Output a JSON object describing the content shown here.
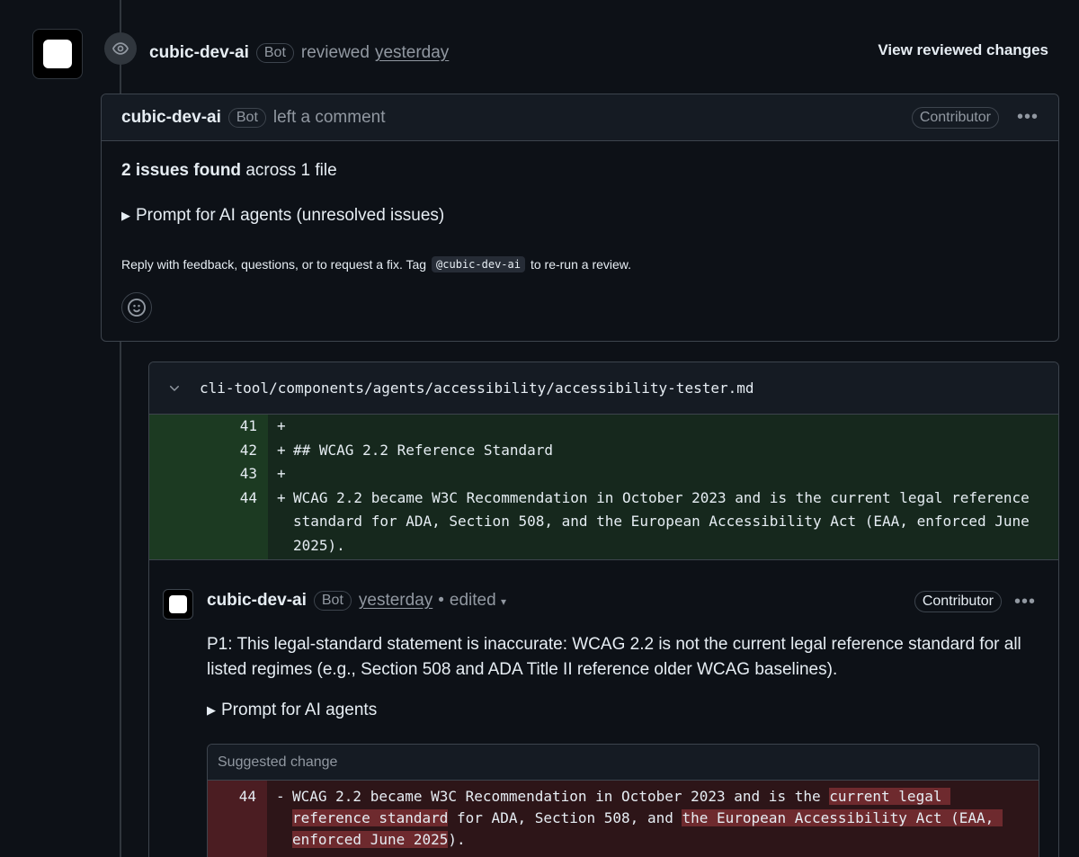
{
  "review": {
    "author": "cubic-dev-ai",
    "bot_label": "Bot",
    "action": "reviewed",
    "time": "yesterday",
    "view_changes": "View reviewed changes"
  },
  "comment": {
    "author": "cubic-dev-ai",
    "bot_label": "Bot",
    "action": "left a comment",
    "role": "Contributor",
    "summary_bold": "2 issues found",
    "summary_rest": "across 1 file",
    "prompt_label": "Prompt for AI agents (unresolved issues)",
    "reply_prefix": "Reply with feedback, questions, or to request a fix. Tag",
    "reply_tag": "@cubic-dev-ai",
    "reply_suffix": "to re-run a review."
  },
  "file": {
    "path": "cli-tool/components/agents/accessibility/accessibility-tester.md",
    "lines": [
      {
        "num": "41",
        "sign": "+",
        "text": ""
      },
      {
        "num": "42",
        "sign": "+",
        "text": "## WCAG 2.2 Reference Standard"
      },
      {
        "num": "43",
        "sign": "+",
        "text": ""
      },
      {
        "num": "44",
        "sign": "+",
        "text": "WCAG 2.2 became W3C Recommendation in October 2023 and is the current legal reference standard for ADA, Section 508, and the European Accessibility Act (EAA, enforced June 2025)."
      }
    ]
  },
  "inline": {
    "author": "cubic-dev-ai",
    "bot_label": "Bot",
    "time": "yesterday",
    "edited": "edited",
    "role": "Contributor",
    "body": "P1: This legal-standard statement is inaccurate: WCAG 2.2 is not the current legal reference standard for all listed regimes (e.g., Section 508 and ADA Title II reference older WCAG baselines).",
    "prompt_label": "Prompt for AI agents",
    "suggest_title": "Suggested change",
    "del_num": "44",
    "del_sign": "-",
    "del_seg1": "WCAG 2.2 became W3C Recommendation in October 2023 and is the ",
    "del_seg2": "current legal reference standard",
    "del_seg3": " for ADA, Section 508, and ",
    "del_seg4": "the European Accessibility Act (EAA, enforced June 2025",
    "del_seg5": ")."
  }
}
